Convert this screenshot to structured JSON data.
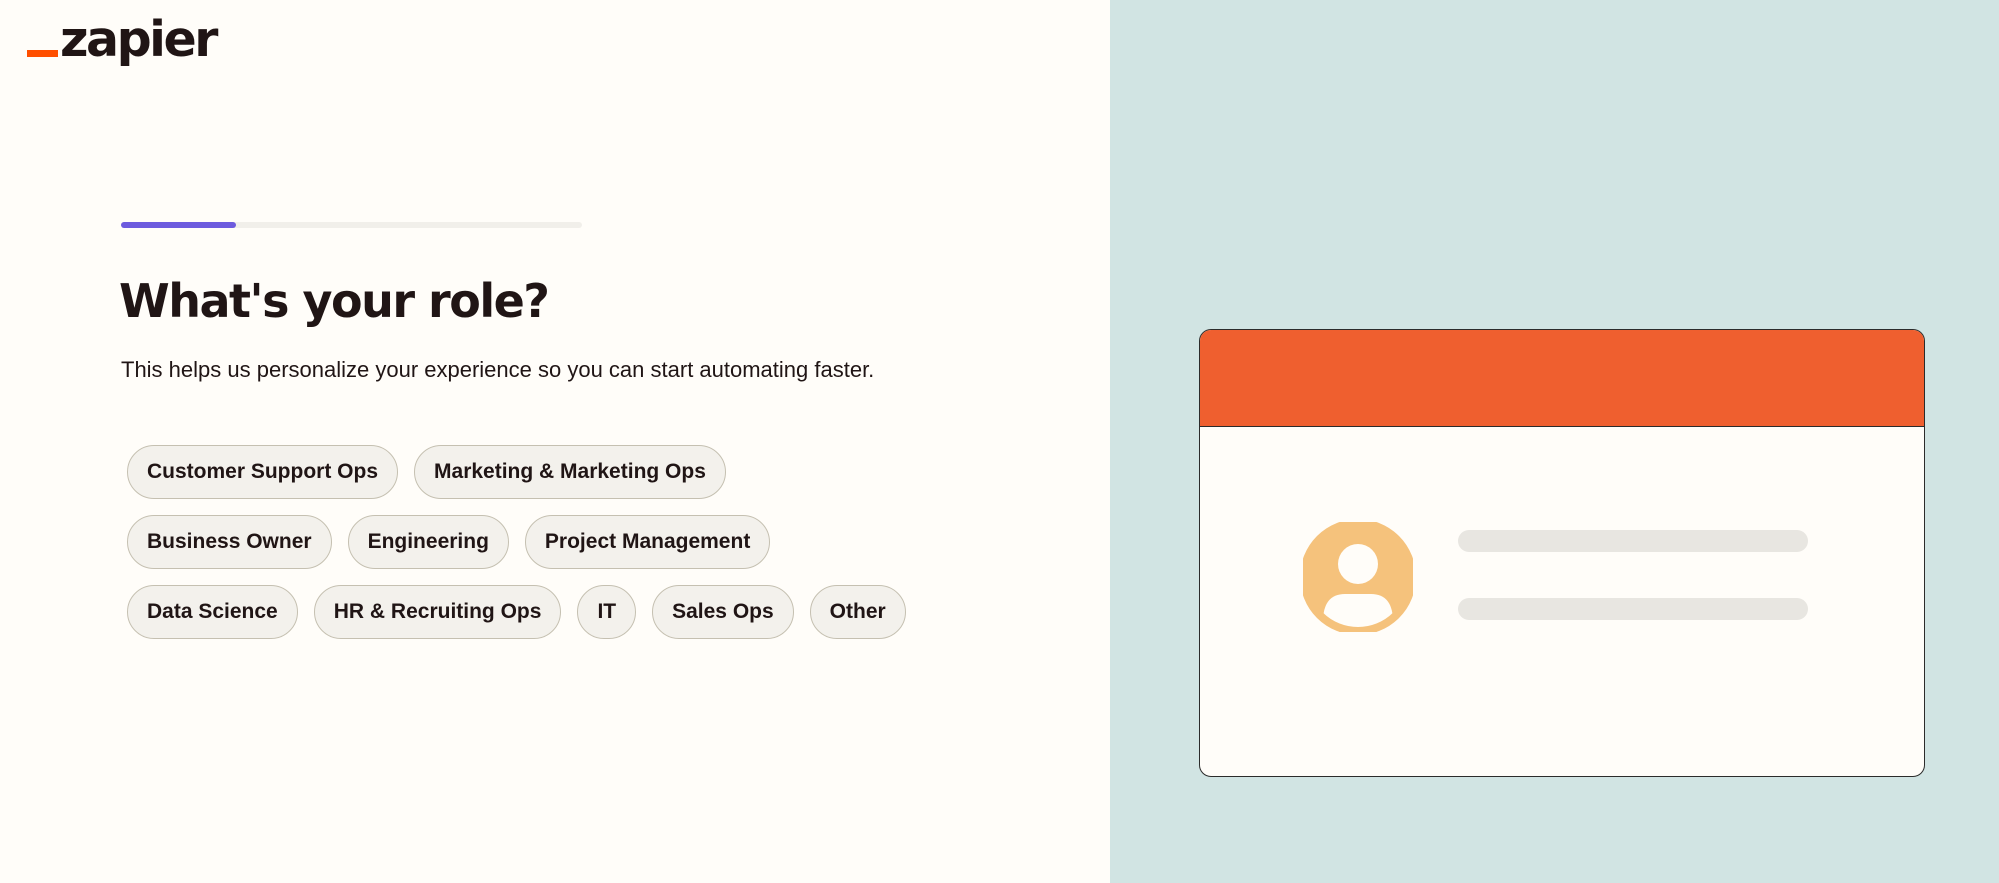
{
  "logo": {
    "text": "zapier",
    "accent_color": "#ff4f00"
  },
  "progress": {
    "value_percent": 25,
    "fill_color": "#6d5bde"
  },
  "header": {
    "title": "What's your role?",
    "subtitle": "This helps us personalize your experience so you can start automating faster."
  },
  "roles": {
    "row1": [
      "Customer Support Ops",
      "Marketing & Marketing Ops"
    ],
    "row2": [
      "Business Owner",
      "Engineering",
      "Project Management"
    ],
    "row3": [
      "Data Science",
      "HR & Recruiting Ops",
      "IT",
      "Sales Ops",
      "Other"
    ]
  },
  "illustration": {
    "header_color": "#ef5f2f",
    "avatar_color": "#f5c27c",
    "panel_background": "#d1e4e3",
    "avatar-icon": "user-avatar-icon"
  }
}
